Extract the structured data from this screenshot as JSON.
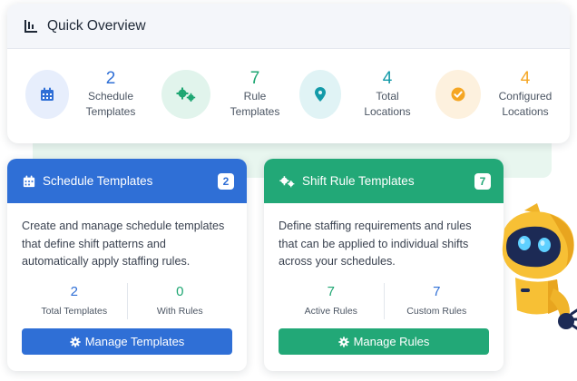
{
  "overview": {
    "title": "Quick Overview",
    "stats": [
      {
        "value": "2",
        "label_line1": "Schedule",
        "label_line2": "Templates",
        "icon": "calendar-icon",
        "color": "#2f6fd6",
        "bg": "#e7eefc"
      },
      {
        "value": "7",
        "label_line1": "Rule",
        "label_line2": "Templates",
        "icon": "cogs-icon",
        "color": "#1ea672",
        "bg": "#e1f4ec"
      },
      {
        "value": "4",
        "label_line1": "Total",
        "label_line2": "Locations",
        "icon": "map-pin-icon",
        "color": "#139aa8",
        "bg": "#e0f3f5"
      },
      {
        "value": "4",
        "label_line1": "Configured",
        "label_line2": "Locations",
        "icon": "check-circle-icon",
        "color": "#f5a623",
        "bg": "#fdf1de"
      }
    ]
  },
  "schedule_card": {
    "title": "Schedule Templates",
    "badge": "2",
    "description": "Create and manage schedule templates that define shift patterns and automatically apply staffing rules.",
    "stats": [
      {
        "value": "2",
        "label": "Total Templates"
      },
      {
        "value": "0",
        "label": "With Rules"
      }
    ],
    "button": "Manage Templates",
    "color": "#2f6fd6"
  },
  "rule_card": {
    "title": "Shift Rule Templates",
    "badge": "7",
    "description": "Define staffing requirements and rules that can be applied to individual shifts across your schedules.",
    "stats": [
      {
        "value": "7",
        "label": "Active Rules"
      },
      {
        "value": "7",
        "label": "Custom Rules"
      }
    ],
    "button": "Manage Rules",
    "color": "#22a877"
  }
}
